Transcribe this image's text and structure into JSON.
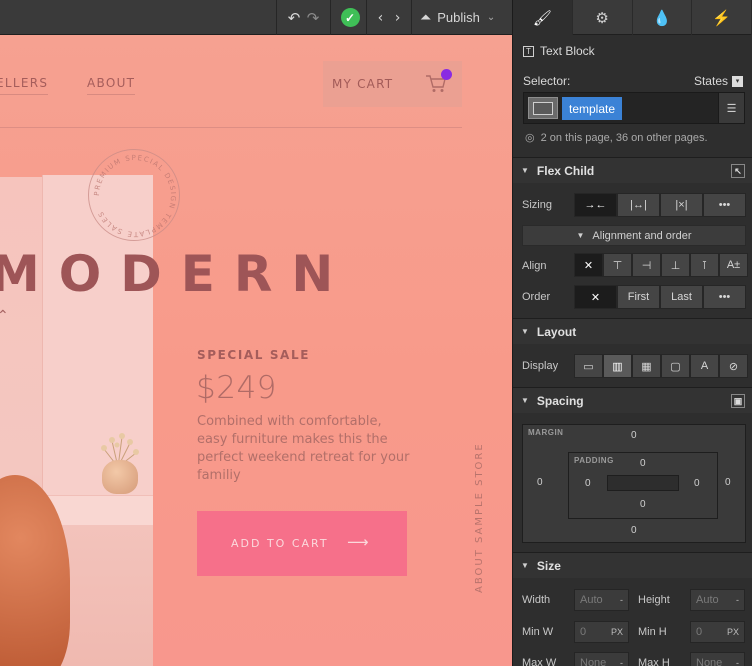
{
  "toolbar": {
    "undo_icon": "undo-icon",
    "redo_icon": "redo-icon",
    "status_icon": "check-icon",
    "code_label": "‹ ›",
    "publish_label": "Publish",
    "status_color": "#3fbf57"
  },
  "canvas": {
    "nav": {
      "sellers": "ELLERS",
      "about": "ABOUT"
    },
    "cart_label": "MY CART",
    "cart_badge_color": "#8a2be2",
    "stamp_text": "PREMIUM SPECIAL DESIGN TEMPLATE SALES",
    "headline": "MODERN",
    "sale_label": "SPECIAL SALE",
    "price": "$249",
    "description": "Combined with comfortable, easy furniture makes this the perfect weekend retreat for your familiy",
    "add_to_cart": "ADD TO CART",
    "arrow": "⟶",
    "vertical_text": "ABOUT SAMPLE STORE",
    "button_color": "#f6708a"
  },
  "panel": {
    "tabs": [
      "brush-icon",
      "gear-icon",
      "drops-icon",
      "bolt-icon"
    ],
    "element_type": "Text Block",
    "selector_label": "Selector:",
    "states_label": "States",
    "class_chip": "template",
    "page_count": "2 on this page, 36 on other pages.",
    "flex_child": {
      "title": "Flex Child",
      "sizing_label": "Sizing",
      "sizing_options": [
        "→←",
        "|↔|",
        "|×|",
        "•••"
      ],
      "align_order_label": "Alignment and order",
      "align_label": "Align",
      "align_options": [
        "✕",
        "⊤",
        "⊣",
        "⊥",
        "⊺",
        "A±"
      ],
      "order_label": "Order",
      "order_options": [
        "✕",
        "First",
        "Last",
        "•••"
      ]
    },
    "layout": {
      "title": "Layout",
      "display_label": "Display",
      "display_options": [
        "▭",
        "▥",
        "▦",
        "▢",
        "A",
        "⊘"
      ]
    },
    "spacing": {
      "title": "Spacing",
      "margin_label": "MARGIN",
      "padding_label": "PADDING",
      "margin": {
        "top": "0",
        "right": "0",
        "bottom": "0",
        "left": "0"
      },
      "padding": {
        "top": "0",
        "right": "0",
        "bottom": "0",
        "left": "0"
      }
    },
    "size": {
      "title": "Size",
      "width_label": "Width",
      "width_value": "Auto",
      "height_label": "Height",
      "height_value": "Auto",
      "minw_label": "Min W",
      "minw_value": "0",
      "minh_label": "Min H",
      "minh_value": "0",
      "maxw_label": "Max W",
      "maxw_value": "None",
      "maxh_label": "Max H",
      "maxh_value": "None",
      "unit_px": "PX",
      "unit_dash": "-"
    },
    "accent_color": "#3b82d6"
  }
}
